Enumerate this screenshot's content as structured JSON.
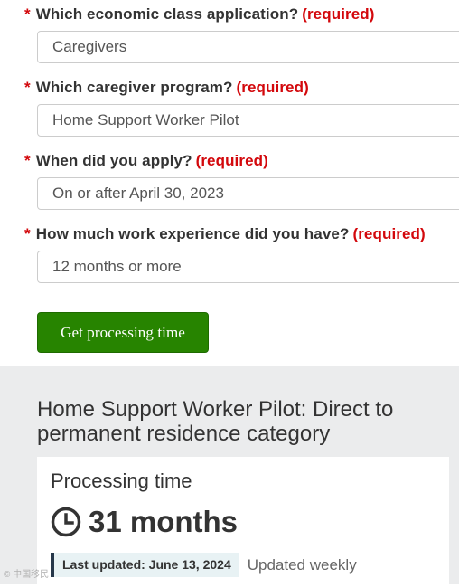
{
  "form": {
    "required_marker": "*",
    "required_text": "(required)",
    "fields": [
      {
        "label": "Which economic class application?",
        "value": "Caregivers"
      },
      {
        "label": "Which caregiver program?",
        "value": "Home Support Worker Pilot"
      },
      {
        "label": "When did you apply?",
        "value": "On or after April 30, 2023"
      },
      {
        "label": "How much work experience did you have?",
        "value": "12 months or more"
      }
    ],
    "submit_label": "Get processing time"
  },
  "result": {
    "title": "Home Support Worker Pilot: Direct to permanent residence category",
    "processing_label": "Processing time",
    "processing_value": "31 months",
    "last_updated": "Last updated: June 13, 2024",
    "update_frequency": "Updated weekly"
  },
  "watermark": "© 中国移民",
  "colors": {
    "required": "#d3080c",
    "button": "#278400",
    "results_bg": "#ebeced",
    "updated_border": "#26374a"
  },
  "icons": {
    "clock": "clock-icon"
  }
}
